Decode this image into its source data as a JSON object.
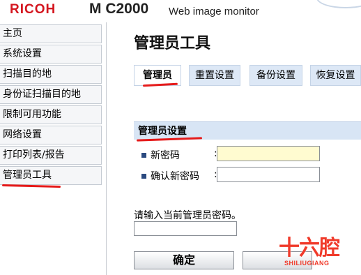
{
  "header": {
    "brand": "RICOH",
    "model": "M C2000",
    "subtitle": "Web image monitor"
  },
  "sidebar": {
    "items": [
      {
        "label": "主页"
      },
      {
        "label": "系统设置"
      },
      {
        "label": "扫描目的地"
      },
      {
        "label": "身份证扫描目的地"
      },
      {
        "label": "限制可用功能"
      },
      {
        "label": "网络设置"
      },
      {
        "label": "打印列表/报告"
      },
      {
        "label": "管理员工具"
      }
    ],
    "selected": "管理员工具"
  },
  "main": {
    "title": "管理员工具",
    "tabs": [
      {
        "label": "管理员",
        "active": true
      },
      {
        "label": "重置设置",
        "active": false
      },
      {
        "label": "备份设置",
        "active": false
      },
      {
        "label": "恢复设置",
        "active": false
      }
    ],
    "section_title": "管理员设置",
    "fields": {
      "new_password_label": "新密码",
      "confirm_password_label": "确认新密码",
      "colon": ":"
    },
    "prompt": "请输入当前管理员密码。",
    "confirm_button": "确定",
    "cancel_button": ""
  },
  "watermark": {
    "cn": "十六腔",
    "en": "SHILIUGIANG"
  },
  "colors": {
    "brand_red": "#d4161f",
    "annotation_red": "#e51a1a",
    "tab_bg": "#dde8f6",
    "section_bg": "#d8e5f5",
    "input_highlight": "#fffbd0"
  }
}
